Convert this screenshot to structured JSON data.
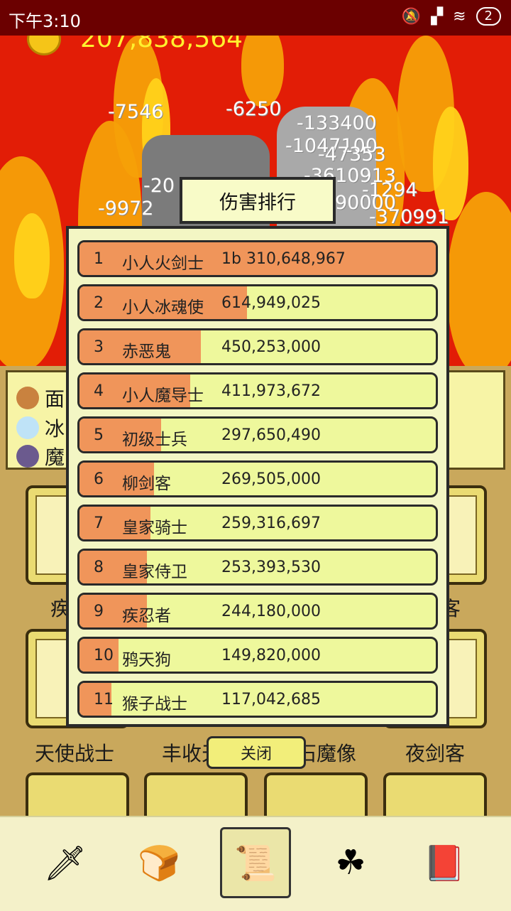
{
  "status_bar": {
    "time": "下午3:10",
    "battery": "2"
  },
  "gold": "207,838,564",
  "damage_numbers": [
    "-7546",
    "-6250",
    "-133400",
    "-1047100",
    "-47353",
    "-20",
    "-9972",
    "-3610913",
    "-1294",
    "90000",
    "-370991"
  ],
  "ranking": {
    "title": "伤害排行",
    "close_label": "关闭",
    "rows": [
      {
        "rank": "1",
        "name": "小人火剑士",
        "value": "1b 310,648,967",
        "fraction": 1.0
      },
      {
        "rank": "2",
        "name": "小人冰魂使",
        "value": "614,949,025",
        "fraction": 0.47
      },
      {
        "rank": "3",
        "name": "赤恶鬼",
        "value": "450,253,000",
        "fraction": 0.34
      },
      {
        "rank": "4",
        "name": "小人魔导士",
        "value": "411,973,672",
        "fraction": 0.31
      },
      {
        "rank": "5",
        "name": "初级士兵",
        "value": "297,650,490",
        "fraction": 0.23
      },
      {
        "rank": "6",
        "name": "柳剑客",
        "value": "269,505,000",
        "fraction": 0.21
      },
      {
        "rank": "7",
        "name": "皇家骑士",
        "value": "259,316,697",
        "fraction": 0.2
      },
      {
        "rank": "8",
        "name": "皇家侍卫",
        "value": "253,393,530",
        "fraction": 0.19
      },
      {
        "rank": "9",
        "name": "疾忍者",
        "value": "244,180,000",
        "fraction": 0.19
      },
      {
        "rank": "10",
        "name": "鸦天狗",
        "value": "149,820,000",
        "fraction": 0.11
      },
      {
        "rank": "11",
        "name": "猴子战士",
        "value": "117,042,685",
        "fraction": 0.09
      }
    ]
  },
  "buffs": [
    "面",
    "冰",
    "魔"
  ],
  "cards_row1_names": [
    "疾",
    "客"
  ],
  "cards_row2_names": [
    "天使战士",
    "丰收天",
    "石魔像",
    "夜剑客"
  ],
  "nav": [
    "sword-icon",
    "bread-icon",
    "scroll-icon",
    "clover-icon",
    "book-icon"
  ],
  "colors": {
    "bar": "#f0955a",
    "row_bg": "#eef89c",
    "gold_text": "#fff12e",
    "background_red": "#e21d06"
  }
}
